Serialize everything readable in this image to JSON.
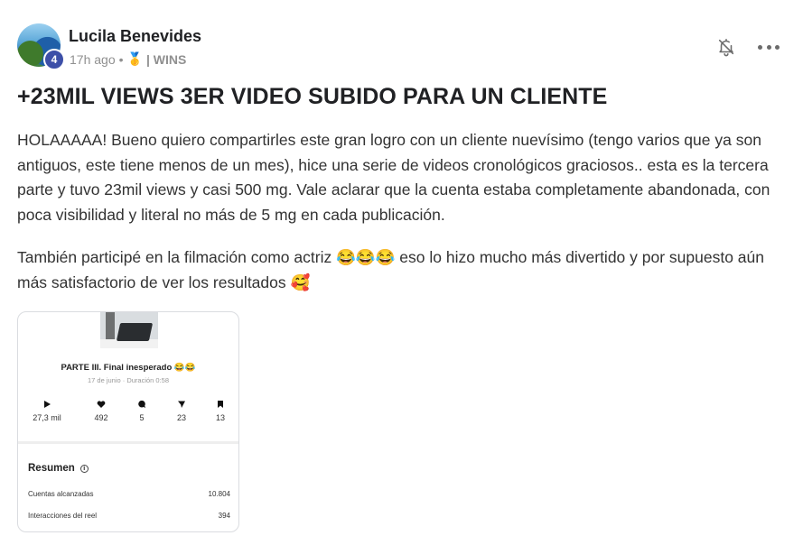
{
  "post": {
    "author": "Lucila Benevides",
    "level": "4",
    "time": "17h ago",
    "separator": "•",
    "category_icon": "🥇",
    "category": "| WINS",
    "title": "+23MIL VIEWS 3ER VIDEO SUBIDO PARA UN CLIENTE",
    "paragraph1": "HOLAAAAA! Bueno quiero compartirles este gran logro con un cliente nuevísimo (tengo varios que ya son antiguos, este tiene menos de un mes), hice una serie de videos cronológicos graciosos.. esta es la tercera parte y tuvo 23mil views y casi 500 mg. Vale aclarar que la cuenta estaba completamente abandonada, con poca visibilidad y literal no más de 5 mg en cada publicación.",
    "paragraph2": "También participé en la filmación como actriz 😂😂😂 eso lo hizo mucho más divertido y por supuesto aún más satisfactorio de ver los resultados 🥰"
  },
  "icons": {
    "bell": "bell-off-icon",
    "more": "more-horizontal-icon",
    "play": "play-icon",
    "heart": "heart-icon",
    "comment": "comment-icon",
    "share": "send-icon",
    "save": "bookmark-icon",
    "info": "info-icon"
  },
  "attachment": {
    "video_title": "PARTE III. Final inesperado 😂😂",
    "video_sub": "17 de junio · Duración 0:58",
    "stats": {
      "plays": "27,3 mil",
      "likes": "492",
      "comments": "5",
      "shares": "23",
      "saves": "13"
    },
    "summary_title": "Resumen",
    "info_glyph": "i",
    "rows": [
      {
        "label": "Cuentas alcanzadas",
        "value": "10.804"
      },
      {
        "label": "Interacciones del reel",
        "value": "394"
      }
    ]
  }
}
